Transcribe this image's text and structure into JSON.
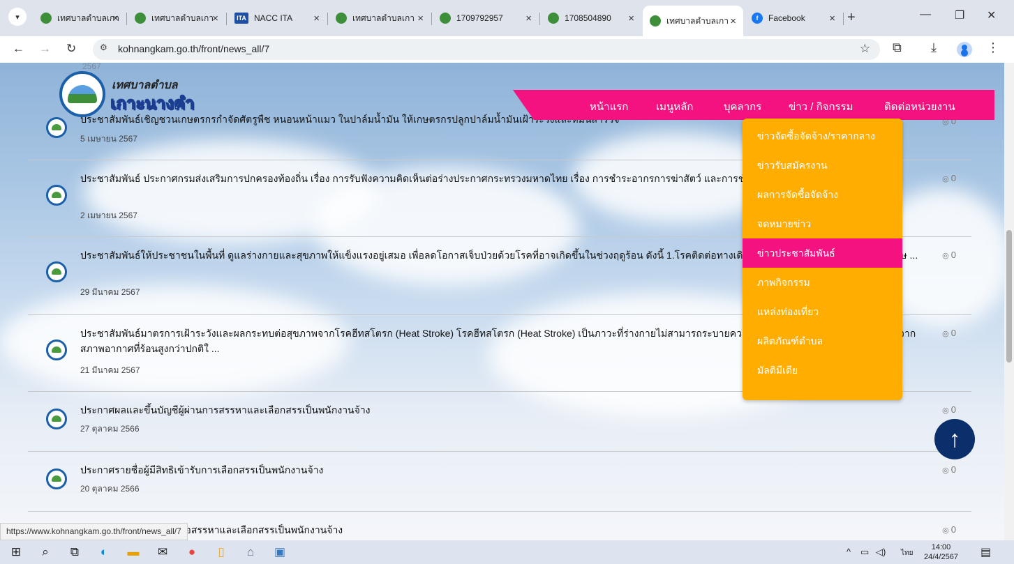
{
  "browser": {
    "tabs": [
      {
        "title": "เทศบาลตำบลเกาะนางคำ",
        "favicon": "site-favicon"
      },
      {
        "title": "เทศบาลตำบลเกาะนางคำ",
        "favicon": "site-favicon"
      },
      {
        "title": "NACC ITA",
        "favicon": "ita-favicon"
      },
      {
        "title": "เทศบาลตำบลเกาะนางคำ",
        "favicon": "site-favicon"
      },
      {
        "title": "1709792957",
        "favicon": "site-favicon"
      },
      {
        "title": "1708504890",
        "favicon": "site-favicon"
      },
      {
        "title": "เทศบาลตำบลเกาะนางคำ",
        "favicon": "site-favicon",
        "active": true
      },
      {
        "title": "Facebook",
        "favicon": "facebook-favicon"
      }
    ],
    "ita_favicon_text": "ITA",
    "url": "kohnangkam.go.th/front/news_all/7",
    "status_url": "https://www.kohnangkam.go.th/front/news_all/7"
  },
  "site": {
    "brand_top": "เทศบาลตำบล",
    "brand_main": "เกาะนางคำ",
    "nav": [
      "หน้าแรก",
      "เมนูหลัก",
      "บุคลากร",
      "ข่าว / กิจกรรม",
      "ติดต่อหน่วยงาน"
    ],
    "dropdown": [
      "ข่าวจัดซื้อจัดจ้าง/ราคากลาง",
      "ข่าวรับสมัครงาน",
      "ผลการจัดซื้อจัดจ้าง",
      "จดหมายข่าว",
      "ข่าวประชาสัมพันธ์",
      "ภาพกิจกรรม",
      "แหล่งท่องเที่ยว",
      "ผลิตภัณฑ์ตำบล",
      "มัลติมีเดีย"
    ],
    "dropdown_active_index": 4
  },
  "news": [
    {
      "title": "ประชาสัมพันธ์เชิญชวนเกษตรกรกำจัดศัตรูพืช หนอนหน้าแมว ในปาล์มน้ำมัน ให้เกษตรกรปลูกปาล์มน้ำมันเฝ้าระวังและหมั่นสำรวจ",
      "date": "5 เมษายน 2567",
      "views": "0"
    },
    {
      "title": "ประชาสัมพันธ์ ประกาศกรมส่งเสริมการปกครองท้องถิ่น เรื่อง การรับฟังความคิดเห็นต่อร่างประกาศกระทรวงมหาดไทย เรื่อง การชำระอากรการฆ่าสัตว์ และการชำระค่าธรรมเนียมการรับรองให้จำห ...",
      "date": "2 เมษายน 2567",
      "views": "0"
    },
    {
      "title": "ประชาสัมพันธ์ให้ประชาชนในพื้นที่ ดูแลร่างกายและสุขภาพให้แข็งแรงอยู่เสมอ เพื่อลดโอกาสเจ็บป่วยด้วยโรคที่อาจเกิดขึ้นในช่วงฤดูร้อน ดังนี้ 1.โรคติดต่อทางเดินอาหาร อุจจาระร่วง โรคอาหารเป็นพิษ ...",
      "date": "29 มีนาคม 2567",
      "views": "0"
    },
    {
      "title": "ประชาสัมพันธ์มาตรการเฝ้าระวังและผลกระทบต่อสุขภาพจากโรคฮีทสโตรก (Heat Stroke) โรคฮีทสโตรก (Heat Stroke) เป็นภาวะที่ร่างกายไม่สามารถระบายความร้อนออกจากร่างกายได้ทัน ร่างกายจากสภาพอากาศที่ร้อนสูงกว่าปกติใ ...",
      "date": "21 มีนาคม 2567",
      "views": "0"
    },
    {
      "title": "ประกาศผลและขึ้นบัญชีผู้ผ่านการสรรหาและเลือกสรรเป็นพนักงานจ้าง",
      "date": "27 ตุลาคม 2566",
      "views": "0"
    },
    {
      "title": "ประกาศรายชื่อผู้มีสิทธิเข้ารับการเลือกสรรเป็นพนักงานจ้าง",
      "date": "20 ตุลาคม 2566",
      "views": "0"
    },
    {
      "title": "ประกาศรับสมัครบุคคลเพื่อสรรหาและเลือกสรรเป็นพนักงานจ้าง",
      "date": "",
      "views": "0"
    }
  ],
  "top_partial_date": "2567",
  "taskbar": {
    "clock_time": "14:00",
    "clock_date": "24/4/2567",
    "lang": "ไทย"
  }
}
